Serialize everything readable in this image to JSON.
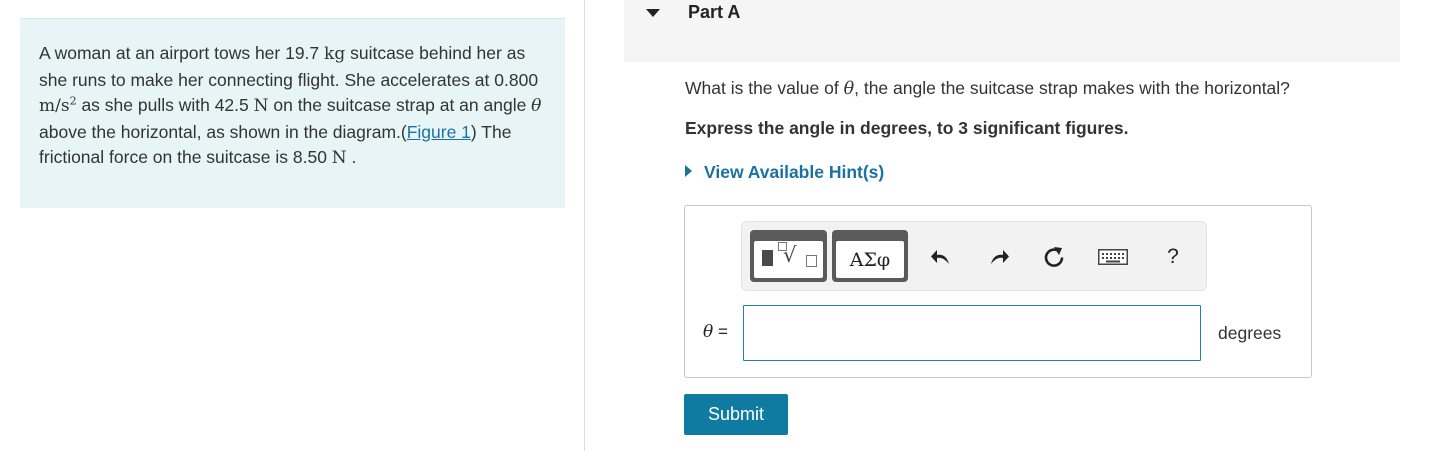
{
  "problem": {
    "t1": "A woman at an airport tows her 19.7 ",
    "u_kg": "kg",
    "t2": " suitcase behind her as she runs to make her connecting flight. She accelerates at 0.800 ",
    "u_accel": "m/s",
    "u_accel_exp": "2",
    "t3": " as she pulls with 42.5 ",
    "u_n1": "N",
    "t4": " on the suitcase strap at an angle ",
    "theta": "θ",
    "t5": " above the horizontal, as shown in the diagram.(",
    "figure_link": "Figure 1",
    "t6": ") The frictional force on the suitcase is 8.50 ",
    "u_n2": "N",
    "t7": " ."
  },
  "part": {
    "title": "Part A"
  },
  "question": {
    "prefix": "What is the value of ",
    "symbol": "θ",
    "suffix": ", the angle the suitcase strap makes with the horizontal?"
  },
  "instruction": "Express the angle in degrees, to 3 significant figures.",
  "hints": {
    "label": "View Available Hint(s)"
  },
  "toolbar": {
    "templates_icon": "sqrt-template-icon",
    "symbols_label": "ΑΣφ",
    "undo_icon": "undo-icon",
    "redo_icon": "redo-icon",
    "reset_icon": "reset-icon",
    "keyboard_icon": "keyboard-icon",
    "help_label": "?"
  },
  "answer": {
    "var_symbol": "θ",
    "equals": " =",
    "value": "",
    "units": "degrees"
  },
  "submit": {
    "label": "Submit"
  },
  "colors": {
    "accent": "#1a72a3",
    "submit_bg": "#0f7ba0",
    "problem_bg": "#e8f5f7"
  }
}
